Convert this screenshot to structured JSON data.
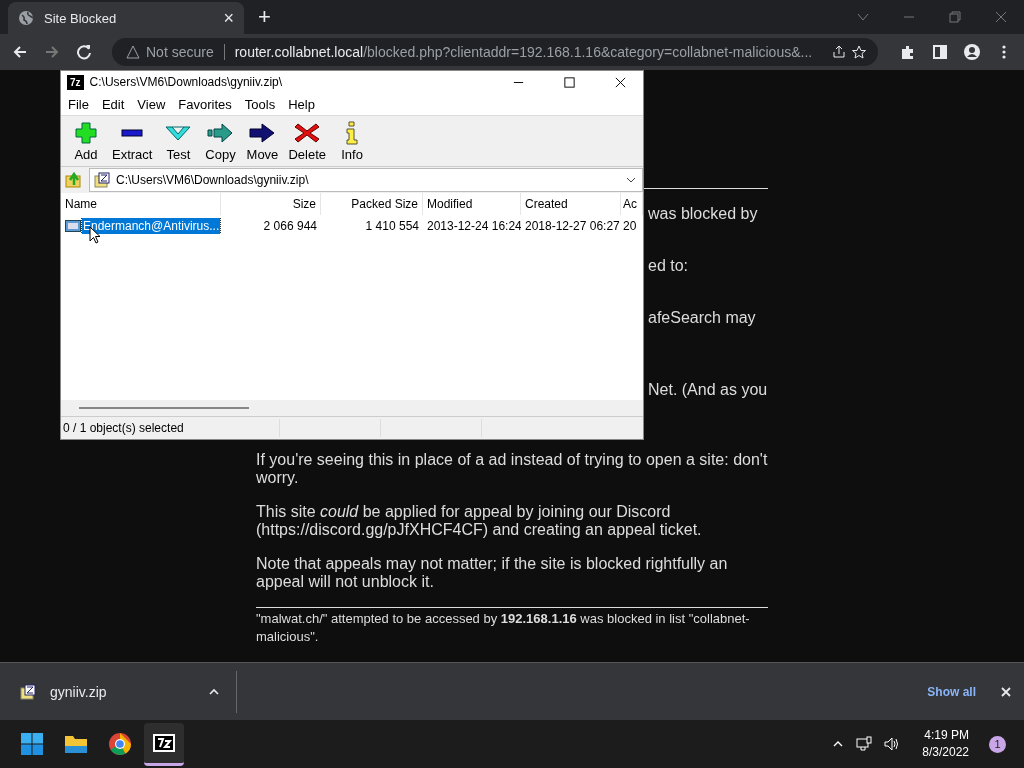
{
  "browser": {
    "tab": {
      "title": "Site Blocked",
      "close": "×"
    },
    "new_tab": "+",
    "address": {
      "security": "Not secure",
      "host": "router.collabnet.local",
      "path": "/blocked.php?clientaddr=192.168.1.16&category=collabnet-malicious&..."
    }
  },
  "page": {
    "fragments": [
      "was blocked by",
      "ed to:",
      "afeSearch may",
      "Net. (And as you"
    ],
    "paragraphs": [
      "If you're seeing this in place of a ad instead of trying to open a site: don't worry.",
      "This site *could* be applied for appeal by joining our Discord (https://discord.gg/pJfXHCF4CF) and creating an appeal ticket.",
      "Note that appeals may not matter; if the site is blocked rightfully an appeal will not unblock it."
    ],
    "footer": "\"malwat.ch/\" attempted to be accessed by **192.168.1.16** was blocked in list \"collabnet-malicious\"."
  },
  "archiver": {
    "title": "C:\\Users\\VM6\\Downloads\\gyniiv.zip\\",
    "logo": "7z",
    "menu": [
      "File",
      "Edit",
      "View",
      "Favorites",
      "Tools",
      "Help"
    ],
    "toolbar": [
      {
        "label": "Add",
        "kind": "add"
      },
      {
        "label": "Extract",
        "kind": "extract"
      },
      {
        "label": "Test",
        "kind": "test"
      },
      {
        "label": "Copy",
        "kind": "copy"
      },
      {
        "label": "Move",
        "kind": "move"
      },
      {
        "label": "Delete",
        "kind": "delete"
      },
      {
        "label": "Info",
        "kind": "info"
      }
    ],
    "path": "C:\\Users\\VM6\\Downloads\\gyniiv.zip\\",
    "columns": [
      "Name",
      "Size",
      "Packed Size",
      "Modified",
      "Created",
      "Ac"
    ],
    "rows": [
      {
        "cells": [
          "Endermanch@Antivirus...",
          "2 066 944",
          "1 410 554",
          "2013-12-24 16:24",
          "2018-12-27 06:27",
          "20"
        ],
        "selected": true
      }
    ],
    "status": "0 / 1 object(s) selected"
  },
  "downloads": {
    "file": "gyniiv.zip",
    "show_all": "Show all"
  },
  "taskbar": {
    "time": "4:19 PM",
    "date": "8/3/2022",
    "notifications": "1"
  }
}
